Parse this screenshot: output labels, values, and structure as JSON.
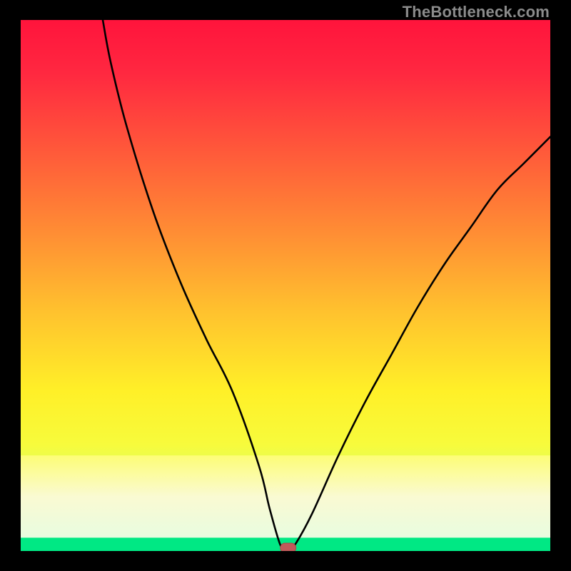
{
  "watermark": "TheBottleneck.com",
  "chart_data": {
    "type": "line",
    "title": "",
    "xlabel": "",
    "ylabel": "",
    "xlim": [
      0,
      100
    ],
    "ylim": [
      0,
      100
    ],
    "gradient_stops": [
      {
        "offset": 0.0,
        "color": "#ff143c"
      },
      {
        "offset": 0.1,
        "color": "#ff2840"
      },
      {
        "offset": 0.25,
        "color": "#ff5a3a"
      },
      {
        "offset": 0.4,
        "color": "#ff8d34"
      },
      {
        "offset": 0.55,
        "color": "#ffc22e"
      },
      {
        "offset": 0.7,
        "color": "#fff028"
      },
      {
        "offset": 0.8,
        "color": "#f7fb3c"
      },
      {
        "offset": 0.9,
        "color": "#ccff7a"
      },
      {
        "offset": 0.95,
        "color": "#7dffb0"
      },
      {
        "offset": 1.0,
        "color": "#00e884"
      }
    ],
    "series": [
      {
        "name": "bottleneck-curve",
        "x": [
          15.5,
          17,
          20,
          25,
          30,
          35,
          40,
          45,
          47,
          49,
          50,
          51,
          52,
          55,
          60,
          65,
          70,
          75,
          80,
          85,
          90,
          95,
          100
        ],
        "y": [
          100,
          92,
          80,
          64,
          51,
          40,
          30,
          16,
          8,
          1.2,
          0.6,
          0.6,
          1.5,
          7,
          18,
          28,
          37,
          46,
          54,
          61,
          68,
          73,
          78
        ]
      }
    ],
    "marker": {
      "x": 50.5,
      "y": 0.6,
      "color_fill": "#c05a5a",
      "color_stroke": "#a84848"
    },
    "green_band": {
      "y_from": 0,
      "y_to": 2.5
    },
    "pale_band": {
      "y_from": 2.5,
      "y_to": 18
    }
  }
}
